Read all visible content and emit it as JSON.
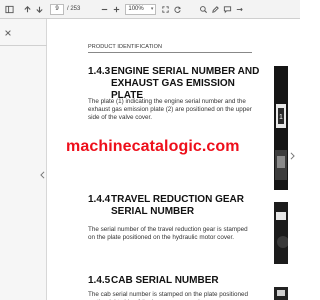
{
  "toolbar": {
    "current_page": "9",
    "total_pages": "/ 253",
    "zoom": "100%",
    "icons": [
      "panel-toggle-icon",
      "page-up-icon",
      "page-down-icon",
      "zoom-out-icon",
      "zoom-in-icon",
      "fit-icon",
      "rotate-icon",
      "search-icon",
      "pen-icon",
      "comment-icon",
      "menu-icon"
    ]
  },
  "doc": {
    "header": "PRODUCT IDENTIFICATION",
    "sections": [
      {
        "num": "1.4.3",
        "title": "ENGINE SERIAL NUMBER AND EXHAUST GAS EMISSION PLATE",
        "body": "The plate (1) indicating the engine serial number and the exhaust gas emission plate (2) are positioned on the upper side of the valve cover."
      },
      {
        "num": "1.4.4",
        "title": "TRAVEL REDUCTION GEAR SERIAL NUMBER",
        "body": "The serial number of the travel reduction gear is stamped on the plate positioned on the hydraulic motor cover."
      },
      {
        "num": "1.4.5",
        "title": "CAB SERIAL NUMBER",
        "body": "The cab serial number is stamped on the plate positioned on the right side of the base cross member."
      }
    ],
    "figure_label": "1"
  },
  "watermark": "machinecatalogic.com"
}
